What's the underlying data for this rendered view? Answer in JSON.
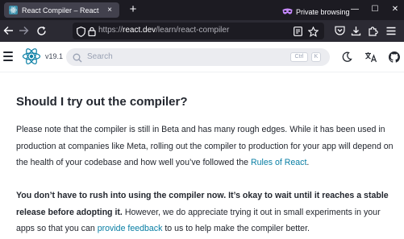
{
  "browser": {
    "tab": {
      "title": "React Compiler – React",
      "close": "×",
      "favicon": "react-icon"
    },
    "new_tab": "+",
    "private_browsing": "Private browsing",
    "window_buttons": {
      "minimize": "—",
      "maximize": "☐",
      "close": "✕"
    },
    "url": {
      "scheme": "https://",
      "host": "react.dev",
      "path": "/learn/react-compiler"
    },
    "nav_icons": [
      "back-arrow-icon",
      "forward-arrow-icon",
      "reload-icon",
      "shield-icon",
      "lock-icon",
      "reader-view-icon",
      "bookmark-star-icon",
      "pocket-icon",
      "downloads-icon",
      "extensions-icon",
      "menu-icon"
    ]
  },
  "site": {
    "version": "v19.1",
    "search": {
      "placeholder": "Search",
      "key1": "Ctrl",
      "key2": "K"
    },
    "brand_color": "#58c4dc"
  },
  "article": {
    "heading": "Should I try out the compiler?",
    "p1": {
      "text": "Please note that the compiler is still in Beta and has many rough edges. While it has been used in production at companies like Meta, rolling out the compiler to production for your app will depend on the health of your codebase and how well you’ve followed the ",
      "link": "Rules of React",
      "end": "."
    },
    "p2": {
      "bold": "You don’t have to rush into using the compiler now. It’s okay to wait until it reaches a stable release before adopting it.",
      "text": " However, we do appreciate trying it out in small experiments in your apps so that you can ",
      "link": "provide feedback",
      "end": " to us to help make the compiler better."
    },
    "link_color": "#087ea4"
  }
}
